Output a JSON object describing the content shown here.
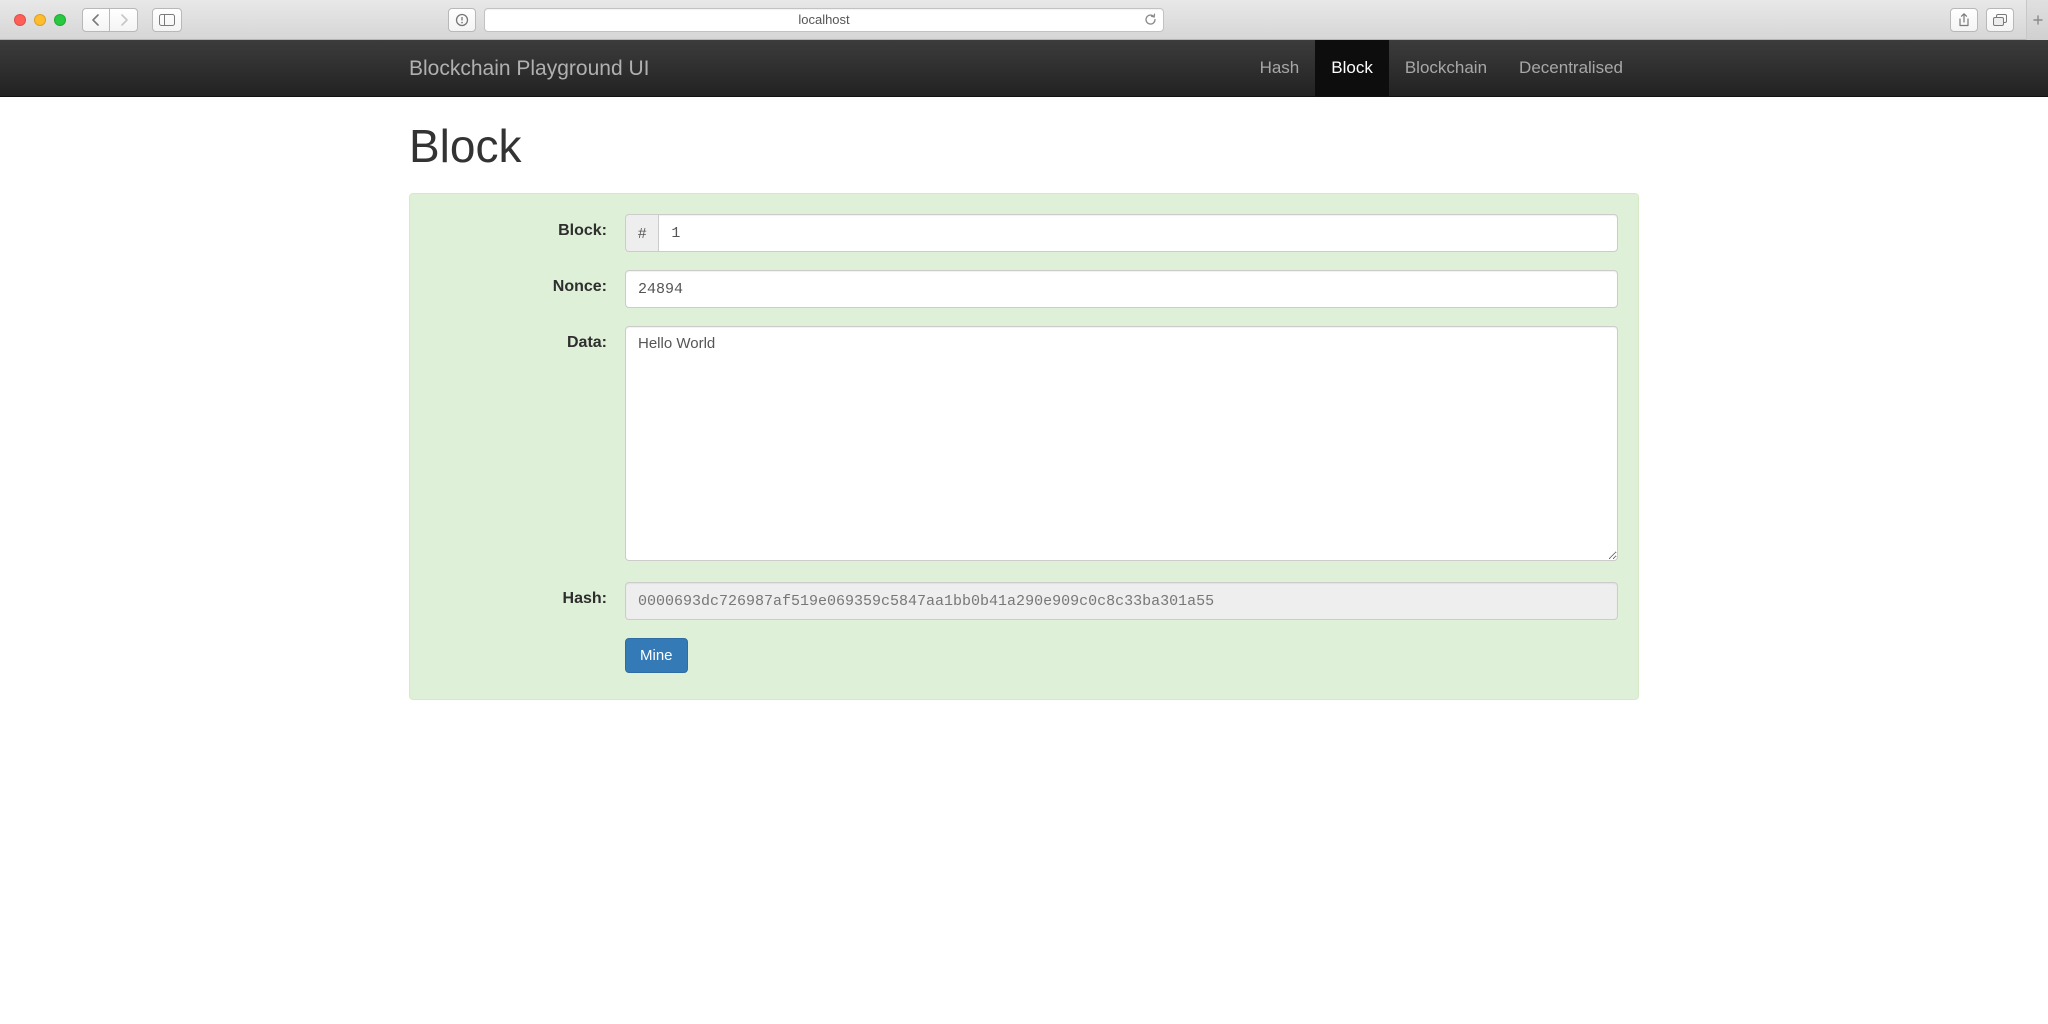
{
  "browser": {
    "url_text": "localhost"
  },
  "navbar": {
    "brand": "Blockchain Playground UI",
    "links": [
      {
        "label": "Hash",
        "active": false
      },
      {
        "label": "Block",
        "active": true
      },
      {
        "label": "Blockchain",
        "active": false
      },
      {
        "label": "Decentralised",
        "active": false
      }
    ]
  },
  "page": {
    "title": "Block",
    "labels": {
      "block": "Block:",
      "nonce": "Nonce:",
      "data": "Data:",
      "hash": "Hash:"
    },
    "block_addon": "#",
    "block_value": "1",
    "nonce_value": "24894",
    "data_value": "Hello World",
    "hash_value": "0000693dc726987af519e069359c5847aa1bb0b41a290e909c0c8c33ba301a55",
    "mine_label": "Mine"
  }
}
